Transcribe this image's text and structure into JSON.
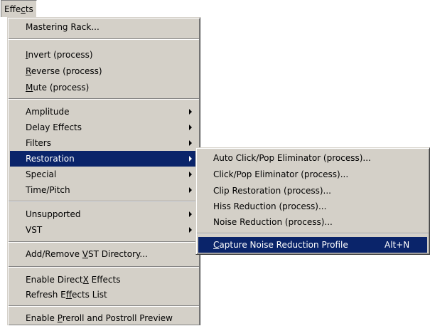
{
  "menubar": {
    "effects": {
      "pre": "Effe",
      "key": "c",
      "post": "ts"
    }
  },
  "main_menu": {
    "mastering_rack": "Mastering Rack...",
    "invert": {
      "key": "I",
      "post": "nvert (process)"
    },
    "reverse": {
      "key": "R",
      "post": "everse (process)"
    },
    "mute": {
      "key": "M",
      "post": "ute (process)"
    },
    "amplitude": "Amplitude",
    "delay_effects": "Delay Effects",
    "filters": "Filters",
    "restoration": "Restoration",
    "special": "Special",
    "time_pitch": "Time/Pitch",
    "unsupported": "Unsupported",
    "vst": "VST",
    "add_remove_vst": {
      "pre": "Add/Remove ",
      "key": "V",
      "post": "ST Directory..."
    },
    "enable_directx": {
      "pre": "Enable Direct",
      "key": "X",
      "post": " Effects"
    },
    "refresh_effects": {
      "pre": "Refresh E",
      "key": "f",
      "post": "fects List"
    },
    "enable_preroll": {
      "pre": "Enable ",
      "key": "P",
      "post": "reroll and Postroll Preview"
    }
  },
  "submenu": {
    "auto_click_pop": "Auto Click/Pop Eliminator (process)...",
    "click_pop": "Click/Pop Eliminator (process)...",
    "clip_restoration": "Clip Restoration (process)...",
    "hiss_reduction": "Hiss Reduction (process)...",
    "noise_reduction": "Noise Reduction (process)...",
    "capture_profile": {
      "key": "C",
      "post": "apture Noise Reduction Profile"
    },
    "capture_shortcut": "Alt+N"
  },
  "colors": {
    "menu_bg": "#d4d0c8",
    "highlight_bg": "#0a246a",
    "highlight_text": "#ffffff"
  },
  "icons": [
    "submenu-arrow-icon"
  ]
}
